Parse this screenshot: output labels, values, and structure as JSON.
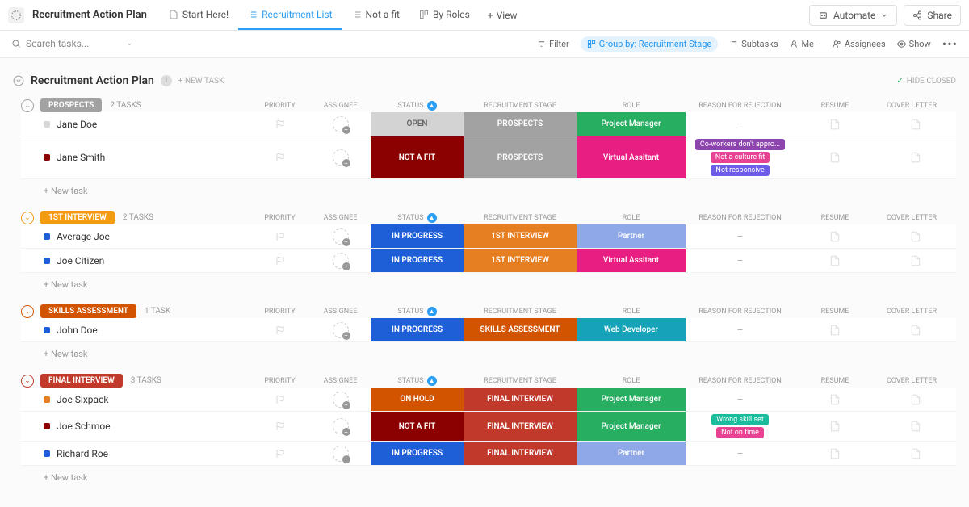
{
  "doc_title": "Recruitment Action Plan",
  "tabs": [
    {
      "label": "Start Here!",
      "icon": "doc"
    },
    {
      "label": "Recruitment List",
      "icon": "list",
      "active": true
    },
    {
      "label": "Not a fit",
      "icon": "list"
    },
    {
      "label": "By Roles",
      "icon": "board"
    }
  ],
  "view_btn": "View",
  "automate": "Automate",
  "share": "Share",
  "search_placeholder": "Search tasks...",
  "toolbar": {
    "filter": "Filter",
    "group_by": "Group by: Recruitment Stage",
    "subtasks": "Subtasks",
    "me": "Me",
    "assignees": "Assignees",
    "show": "Show"
  },
  "list_title": "Recruitment Action Plan",
  "new_task_label": "+ NEW TASK",
  "hide_closed": "HIDE CLOSED",
  "new_task_row": "+ New task",
  "columns": {
    "priority": "PRIORITY",
    "assignee": "ASSIGNEE",
    "status": "STATUS",
    "stage": "RECRUITMENT STAGE",
    "role": "ROLE",
    "reason": "REASON FOR REJECTION",
    "resume": "RESUME",
    "cover": "COVER LETTER"
  },
  "groups": [
    {
      "name": "PROSPECTS",
      "badge_bg": "#a2a2a2",
      "ring": "#a2a2a2",
      "count": "2 TASKS",
      "tasks": [
        {
          "name": "Jane Doe",
          "dot": "#d8d8d8",
          "status": "OPEN",
          "status_bg": "#d3d3d3",
          "status_fg": "#666",
          "stage": "PROSPECTS",
          "stage_bg": "#a2a2a2",
          "role": "Project Manager",
          "role_bg": "#27ae60",
          "reasons": []
        },
        {
          "name": "Jane Smith",
          "dot": "#8b0000",
          "status": "NOT A FIT",
          "status_bg": "#8b0000",
          "stage": "PROSPECTS",
          "stage_bg": "#a2a2a2",
          "role": "Virtual Assitant",
          "role_bg": "#e91e82",
          "reasons": [
            {
              "text": "Co-workers don't appro...",
              "bg": "#8e44ad"
            },
            {
              "text": "Not a culture fit",
              "bg": "#e84393"
            },
            {
              "text": "Not responsive",
              "bg": "#6c5ce7"
            }
          ]
        }
      ]
    },
    {
      "name": "1ST INTERVIEW",
      "badge_bg": "#f39c12",
      "ring": "#f39c12",
      "count": "2 TASKS",
      "tasks": [
        {
          "name": "Average Joe",
          "dot": "#1e5fd8",
          "status": "IN PROGRESS",
          "status_bg": "#1e5fd8",
          "stage": "1ST INTERVIEW",
          "stage_bg": "#e67e22",
          "role": "Partner",
          "role_bg": "#8fa8e8",
          "reasons": []
        },
        {
          "name": "Joe Citizen",
          "dot": "#1e5fd8",
          "status": "IN PROGRESS",
          "status_bg": "#1e5fd8",
          "stage": "1ST INTERVIEW",
          "stage_bg": "#e67e22",
          "role": "Virtual Assitant",
          "role_bg": "#e91e82",
          "reasons": []
        }
      ]
    },
    {
      "name": "SKILLS ASSESSMENT",
      "badge_bg": "#d35400",
      "ring": "#d35400",
      "count": "1 TASK",
      "tasks": [
        {
          "name": "John Doe",
          "dot": "#1e5fd8",
          "status": "IN PROGRESS",
          "status_bg": "#1e5fd8",
          "stage": "SKILLS ASSESSMENT",
          "stage_bg": "#d35400",
          "role": "Web Developer",
          "role_bg": "#16a2b8",
          "reasons": []
        }
      ]
    },
    {
      "name": "FINAL INTERVIEW",
      "badge_bg": "#c0392b",
      "ring": "#c0392b",
      "count": "3 TASKS",
      "tasks": [
        {
          "name": "Joe Sixpack",
          "dot": "#e67e22",
          "status": "ON HOLD",
          "status_bg": "#d35400",
          "stage": "FINAL INTERVIEW",
          "stage_bg": "#c0392b",
          "role": "Project Manager",
          "role_bg": "#27ae60",
          "reasons": []
        },
        {
          "name": "Joe Schmoe",
          "dot": "#8b0000",
          "status": "NOT A FIT",
          "status_bg": "#8b0000",
          "stage": "FINAL INTERVIEW",
          "stage_bg": "#c0392b",
          "role": "Project Manager",
          "role_bg": "#27ae60",
          "reasons": [
            {
              "text": "Wrong skill set",
              "bg": "#1abc9c"
            },
            {
              "text": "Not on time",
              "bg": "#e84393"
            }
          ]
        },
        {
          "name": "Richard Roe",
          "dot": "#1e5fd8",
          "status": "IN PROGRESS",
          "status_bg": "#1e5fd8",
          "stage": "FINAL INTERVIEW",
          "stage_bg": "#c0392b",
          "role": "Partner",
          "role_bg": "#8fa8e8",
          "reasons": []
        }
      ]
    }
  ]
}
